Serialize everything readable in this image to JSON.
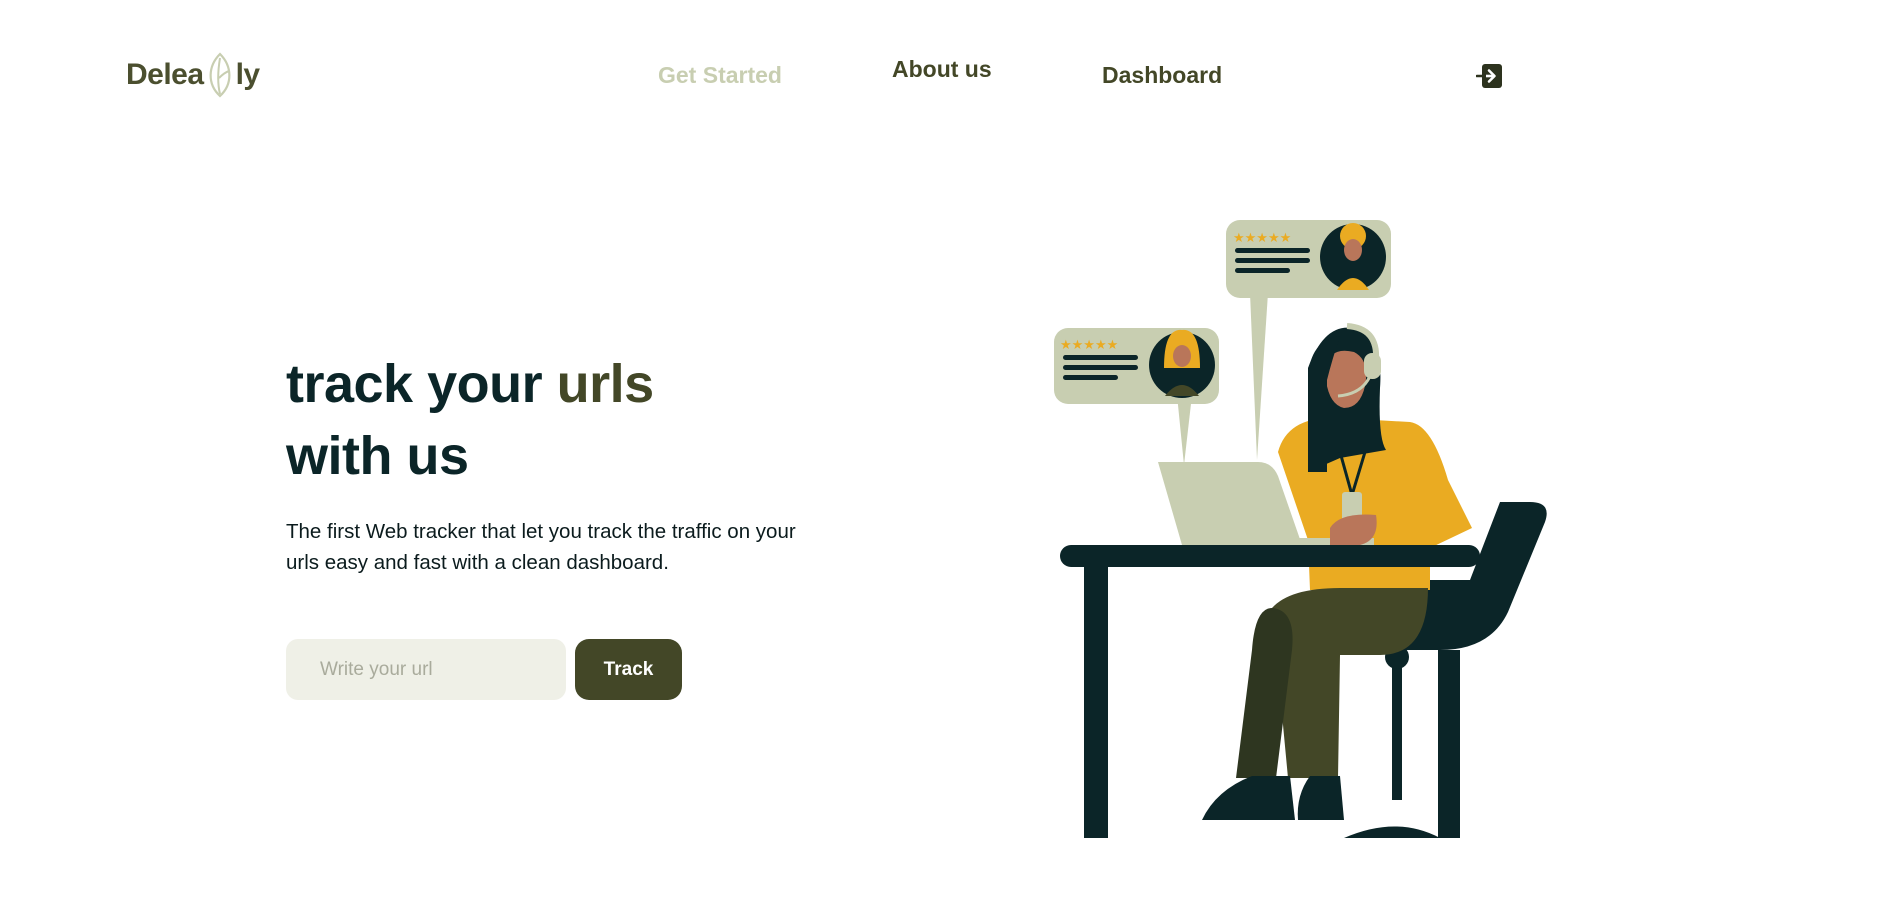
{
  "brand": {
    "name_prefix": "Delea",
    "name_suffix": "ly",
    "leaf_icon": "leaf-icon"
  },
  "nav": {
    "links": [
      {
        "label": "Get Started",
        "color": "#c8ceb1"
      },
      {
        "label": "About us",
        "color": "#434727"
      },
      {
        "label": "Dashboard",
        "color": "#434727"
      }
    ],
    "login_icon": "login-icon"
  },
  "hero": {
    "title_part1": "track your ",
    "title_accent": "urls",
    "title_part2": "with us",
    "subtitle": "The first Web tracker that let you track the traffic on your urls easy and fast with a clean dashboard.",
    "input_placeholder": "Write your url",
    "input_value": "",
    "button_label": "Track"
  },
  "colors": {
    "primary_dark": "#0b2528",
    "olive": "#434727",
    "light_sage": "#c8ceb1",
    "input_bg": "#eff0e7",
    "accent_yellow": "#eaab22"
  },
  "illustration": {
    "name": "customer-support-illustration",
    "review_stars": 5
  }
}
